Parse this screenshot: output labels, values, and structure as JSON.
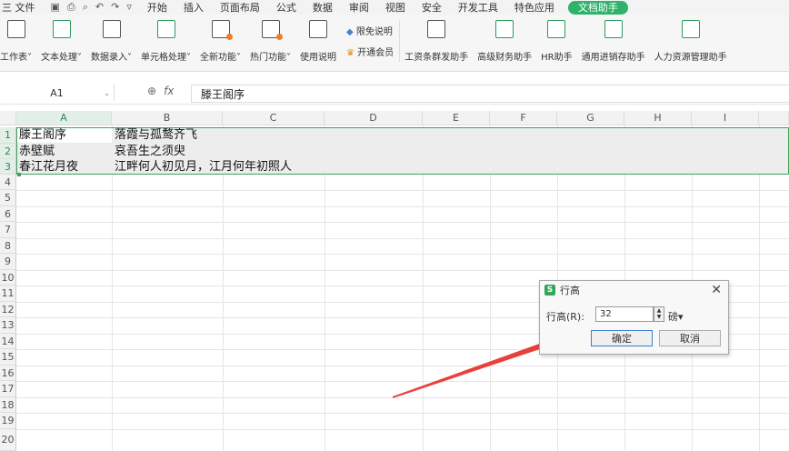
{
  "menubar": {
    "file": "三 文件",
    "tabs": [
      "开始",
      "插入",
      "页面布局",
      "公式",
      "数据",
      "审阅",
      "视图",
      "安全",
      "开发工具",
      "特色应用"
    ],
    "active_tab": "文档助手"
  },
  "ribbon": {
    "buttons": [
      "工作表˅",
      "文本处理˅",
      "数据录入˅",
      "单元格处理˅",
      "全新功能˅",
      "热门功能˅",
      "使用说明"
    ],
    "small": {
      "disclaimer": "限免说明",
      "vip": "开通会员"
    },
    "helpers": [
      "工资条群发助手",
      "高级财务助手",
      "HR助手",
      "通用进销存助手",
      "人力资源管理助手"
    ]
  },
  "formula_bar": {
    "cell_ref": "A1",
    "fx": "fx",
    "content": "滕王阁序"
  },
  "columns": [
    "A",
    "B",
    "C",
    "D",
    "E",
    "F",
    "G",
    "H",
    "I"
  ],
  "rows": [
    "1",
    "2",
    "3",
    "4",
    "5",
    "6",
    "7",
    "8",
    "9",
    "10",
    "11",
    "12",
    "13",
    "14",
    "15",
    "16",
    "17",
    "18",
    "19",
    "20"
  ],
  "cells": {
    "A1": "滕王阁序",
    "B1": "落霞与孤鹜齐飞",
    "A2": "赤壁赋",
    "B2": "哀吾生之须臾",
    "A3": "春江花月夜",
    "B3": "江畔何人初见月，江月何年初照人"
  },
  "dialog": {
    "title": "行高",
    "label": "行高(R):",
    "value": "32",
    "unit": "磅▾",
    "ok": "确定",
    "cancel": "取消",
    "close": "✕"
  },
  "colors": {
    "accent": "#2fb26b",
    "selection_border": "#3aa55c",
    "arrow": "#e8413c"
  }
}
